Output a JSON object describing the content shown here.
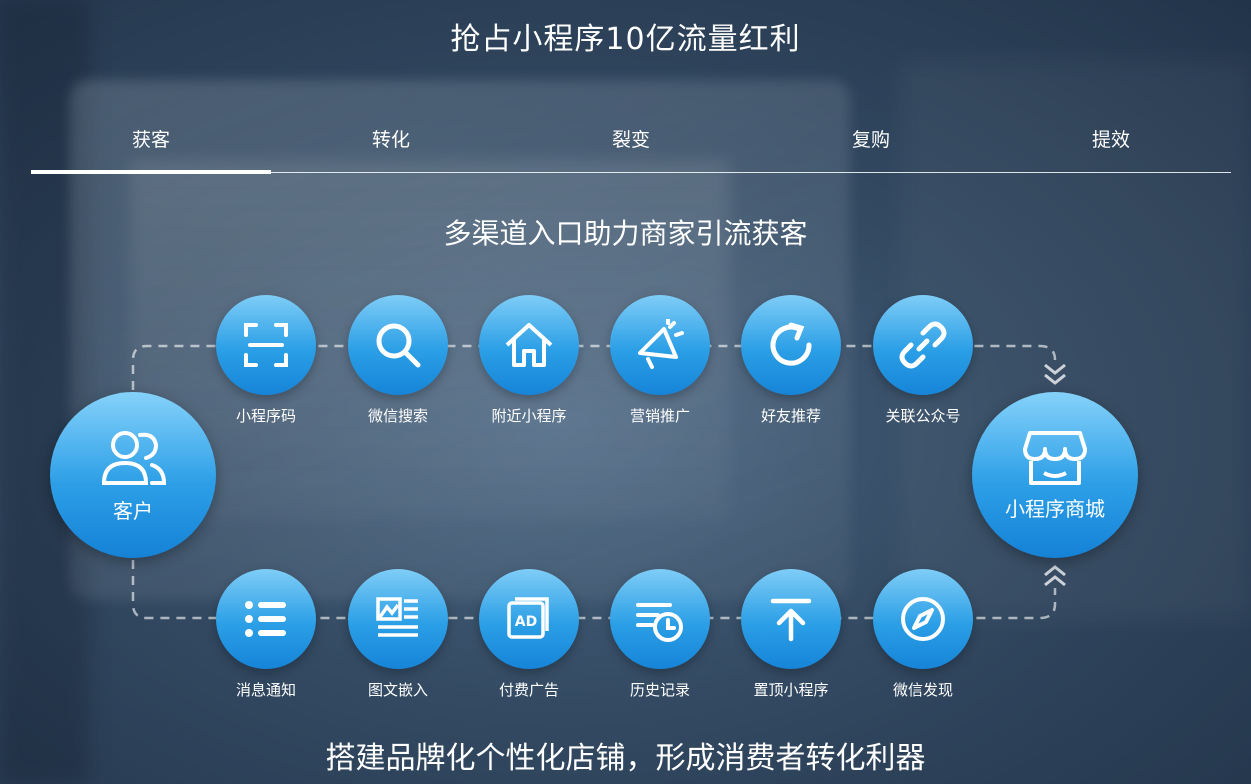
{
  "page_title": "抢占小程序10亿流量红利",
  "tabs": [
    {
      "label": "获客",
      "active": true
    },
    {
      "label": "转化",
      "active": false
    },
    {
      "label": "裂变",
      "active": false
    },
    {
      "label": "复购",
      "active": false
    },
    {
      "label": "提效",
      "active": false
    }
  ],
  "section_title": "多渠道入口助力商家引流获客",
  "customer": {
    "label": "客户",
    "icon": "users-icon"
  },
  "mall": {
    "label": "小程序商城",
    "icon": "store-icon"
  },
  "top_channels": [
    {
      "label": "小程序码",
      "icon": "scan-icon"
    },
    {
      "label": "微信搜索",
      "icon": "search-icon"
    },
    {
      "label": "附近小程序",
      "icon": "home-icon"
    },
    {
      "label": "营销推广",
      "icon": "megaphone-icon"
    },
    {
      "label": "好友推荐",
      "icon": "refresh-icon"
    },
    {
      "label": "关联公众号",
      "icon": "link-icon"
    }
  ],
  "bottom_channels": [
    {
      "label": "消息通知",
      "icon": "list-icon"
    },
    {
      "label": "图文嵌入",
      "icon": "article-icon"
    },
    {
      "label": "付费广告",
      "icon": "ad-icon"
    },
    {
      "label": "历史记录",
      "icon": "history-icon"
    },
    {
      "label": "置顶小程序",
      "icon": "pin-top-icon"
    },
    {
      "label": "微信发现",
      "icon": "compass-icon"
    }
  ],
  "bottom_title": "搭建品牌化个性化店铺，形成消费者转化利器"
}
